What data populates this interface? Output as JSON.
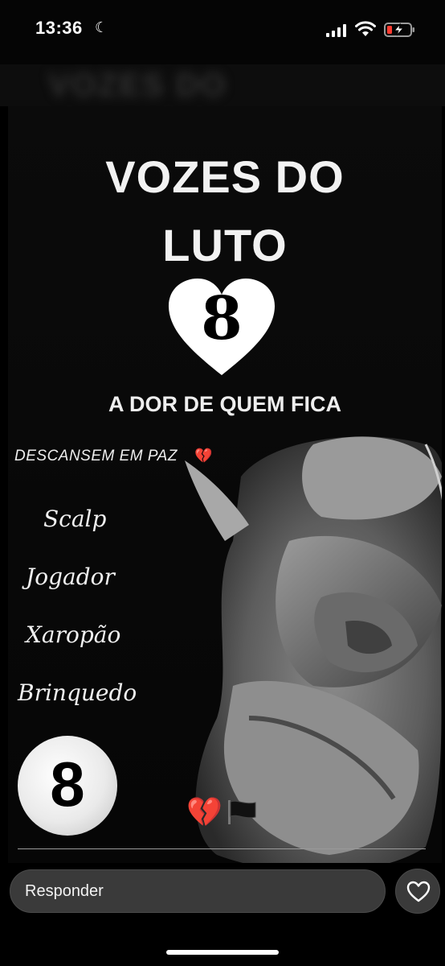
{
  "status_bar": {
    "time": "13:36",
    "moon_icon": "moon-icon",
    "signal_icon": "cellular-signal-icon",
    "wifi_icon": "wifi-icon",
    "battery_icon": "battery-charging-icon",
    "battery_color": "#ff3b30"
  },
  "blurred_header": "VOZES DO",
  "story": {
    "title_line1": "VOZES DO",
    "title_line2": "LUTO",
    "heart_number": "8",
    "subtitle": "A DOR DE QUEM FICA",
    "rip_text": "DESCANSEM EM PAZ",
    "rip_emoji": "💔",
    "names": [
      "Scalp",
      "Jogador",
      "Xaropão",
      "Brinquedo"
    ],
    "ball_number": "8",
    "broken_heart_emoji": "💔",
    "flag_icon": "black-flag-icon"
  },
  "reply_bar": {
    "placeholder": "Responder",
    "like_icon": "heart-outline-icon"
  }
}
